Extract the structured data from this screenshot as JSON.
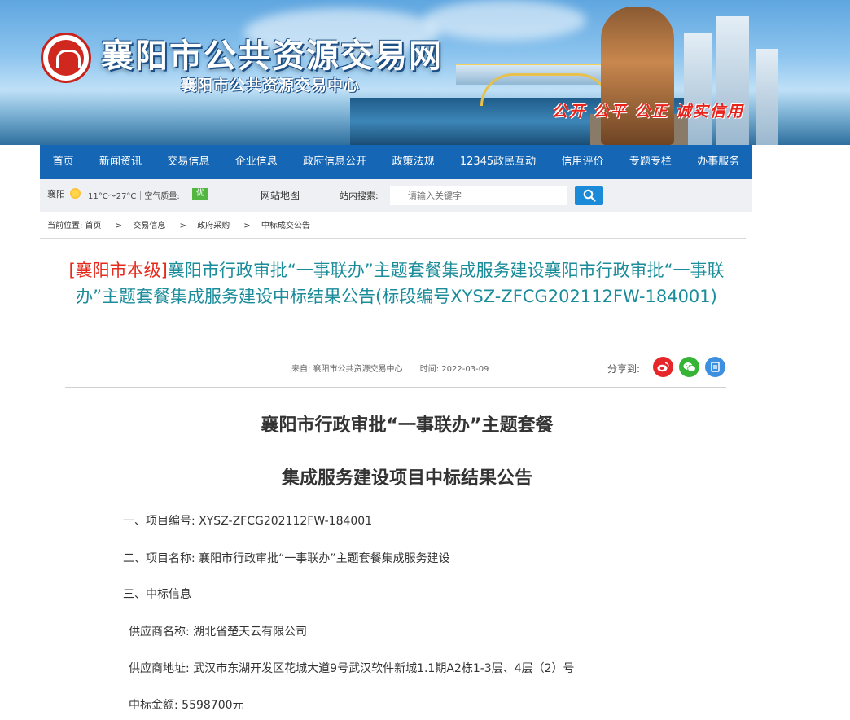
{
  "header": {
    "site_title": "襄阳市公共资源交易网",
    "site_subtitle": "襄阳市公共资源交易中心",
    "slogan": "公开 公平 公正 诚实信用"
  },
  "nav": {
    "items": [
      "首页",
      "新闻资讯",
      "交易信息",
      "企业信息",
      "政府信息公开",
      "政策法规",
      "12345政民互动",
      "信用评价",
      "专题专栏",
      "办事服务"
    ]
  },
  "infobar": {
    "city": "襄阳",
    "weather": "11°C～27°C｜空气质量:",
    "air_quality": "优",
    "sitemap": "网站地图",
    "search_label": "站内搜索:",
    "search_placeholder": "请输入关键字"
  },
  "breadcrumb": {
    "items": [
      "当前位置: 首页",
      "交易信息",
      "政府采购",
      "中标成交公告"
    ],
    "separator": ">"
  },
  "article": {
    "tag": "[襄阳市本级]",
    "title": "襄阳市行政审批“一事联办”主题套餐集成服务建设襄阳市行政审批“一事联办”主题套餐集成服务建设中标结果公告(标段编号XYSZ-ZFCG202112FW-184001)",
    "source": "来自: 襄阳市公共资源交易中心",
    "time": "时间: 2022-03-09",
    "share_label": "分享到:"
  },
  "content": {
    "heading_line1": "襄阳市行政审批“一事联办”主题套餐",
    "heading_line2": "集成服务建设项目中标结果公告",
    "paragraphs": [
      "一、项目编号: XYSZ-ZFCG202112FW-184001",
      "二、项目名称: 襄阳市行政审批“一事联办”主题套餐集成服务建设",
      "三、中标信息",
      "供应商名称: 湖北省楚天云有限公司",
      "供应商地址: 武汉市东湖开发区花城大道9号武汉软件新城1.1期A2栋1-3层、4层（2）号",
      "中标金额: 5598700元"
    ]
  },
  "colors": {
    "nav_bg": "#1566b4",
    "title_teal": "#1a8c9a",
    "tag_red": "#e52a1b",
    "search_btn": "#1b8ad8",
    "aq_green": "#52b640"
  },
  "icons": [
    "logo-seal",
    "sun-icon",
    "search-icon",
    "weibo-icon",
    "wechat-icon",
    "qzone-icon"
  ]
}
